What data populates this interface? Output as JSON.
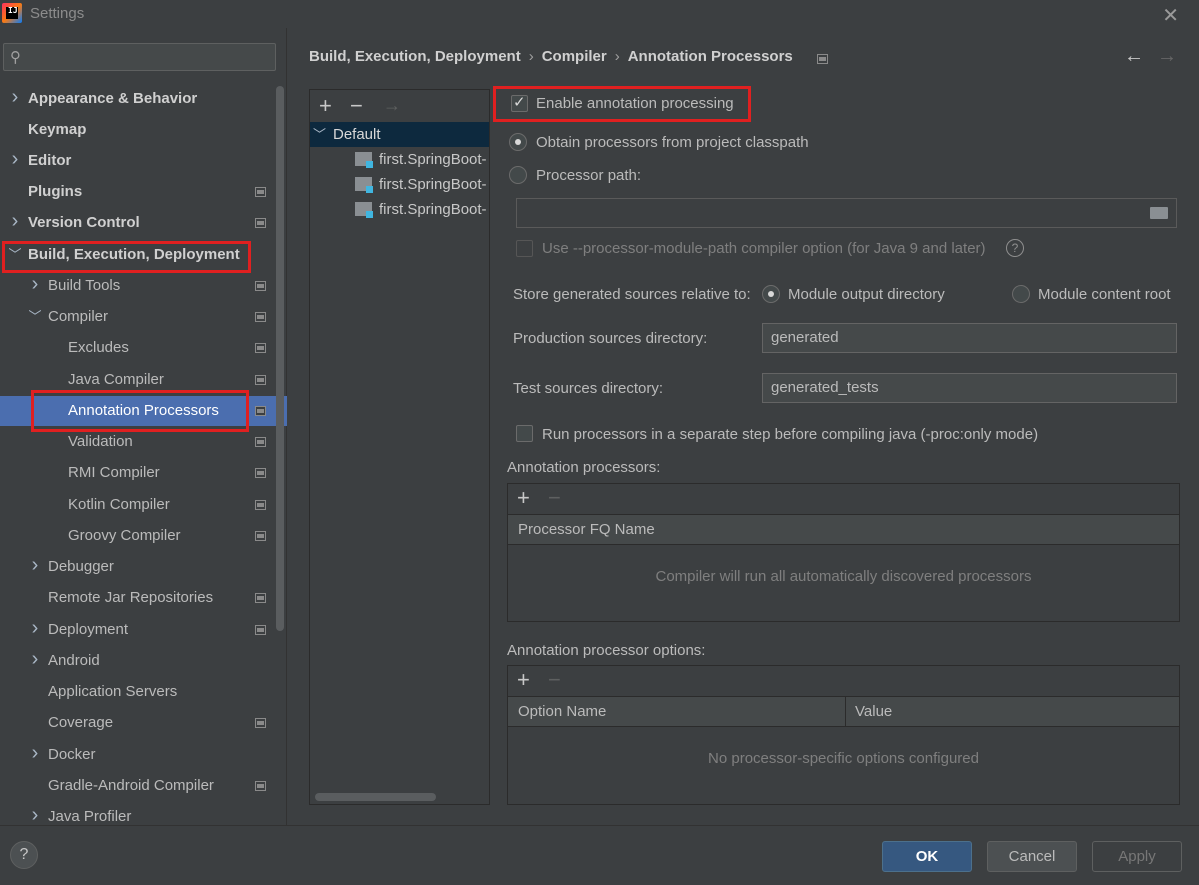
{
  "window": {
    "title": "Settings",
    "close_label": "✕"
  },
  "search": {
    "placeholder": ""
  },
  "sidebar": {
    "items": [
      {
        "label": "Appearance & Behavior",
        "expandable": true
      },
      {
        "label": "Keymap",
        "expandable": false
      },
      {
        "label": "Editor",
        "expandable": true
      },
      {
        "label": "Plugins",
        "expandable": false
      },
      {
        "label": "Version Control",
        "expandable": true
      },
      {
        "label": "Build, Execution, Deployment",
        "expandable": true,
        "expanded": true
      },
      {
        "label": "Build Tools",
        "expandable": true
      },
      {
        "label": "Compiler",
        "expandable": true,
        "expanded": true
      },
      {
        "label": "Excludes"
      },
      {
        "label": "Java Compiler"
      },
      {
        "label": "Annotation Processors",
        "selected": true
      },
      {
        "label": "Validation"
      },
      {
        "label": "RMI Compiler"
      },
      {
        "label": "Kotlin Compiler"
      },
      {
        "label": "Groovy Compiler"
      },
      {
        "label": "Debugger",
        "expandable": true
      },
      {
        "label": "Remote Jar Repositories"
      },
      {
        "label": "Deployment",
        "expandable": true
      },
      {
        "label": "Android",
        "expandable": true
      },
      {
        "label": "Application Servers"
      },
      {
        "label": "Coverage"
      },
      {
        "label": "Docker",
        "expandable": true
      },
      {
        "label": "Gradle-Android Compiler"
      },
      {
        "label": "Java Profiler",
        "expandable": true
      }
    ]
  },
  "breadcrumb": {
    "items": [
      "Build, Execution, Deployment",
      "Compiler",
      "Annotation Processors"
    ],
    "separator": "›"
  },
  "nav": {
    "back": "←",
    "forward": "→"
  },
  "profiles": {
    "toolbar": {
      "add": "+",
      "remove": "−",
      "move": "→"
    },
    "default_label": "Default",
    "modules": [
      "first.SpringBoot-",
      "first.SpringBoot-",
      "first.SpringBoot-"
    ]
  },
  "form": {
    "enable_label": "Enable annotation processing",
    "enable_checked": true,
    "obtain_label": "Obtain processors from project classpath",
    "processor_path_label": "Processor path:",
    "processor_path_value": "",
    "module_path_label": "Use --processor-module-path compiler option (for Java 9 and later)",
    "help_glyph": "?",
    "store_label": "Store generated sources relative to:",
    "module_output_label": "Module output directory",
    "module_content_label": "Module content root",
    "production_dir_label": "Production sources directory:",
    "production_dir_value": "generated",
    "test_dir_label": "Test sources directory:",
    "test_dir_value": "generated_tests",
    "run_separate_label": "Run processors in a separate step before compiling java (-proc:only mode)"
  },
  "processors_table": {
    "section_label": "Annotation processors:",
    "add": "+",
    "remove": "−",
    "column": "Processor FQ Name",
    "empty_text": "Compiler will run all automatically discovered processors"
  },
  "options_table": {
    "section_label": "Annotation processor options:",
    "add": "+",
    "remove": "−",
    "columns": [
      "Option Name",
      "Value"
    ],
    "empty_text": "No processor-specific options configured"
  },
  "buttons": {
    "help": "?",
    "ok": "OK",
    "cancel": "Cancel",
    "apply": "Apply"
  },
  "colors": {
    "background": "#3c3f41",
    "selection": "#4b6eaf",
    "highlight_box": "#e02020",
    "ok_button": "#365880"
  }
}
